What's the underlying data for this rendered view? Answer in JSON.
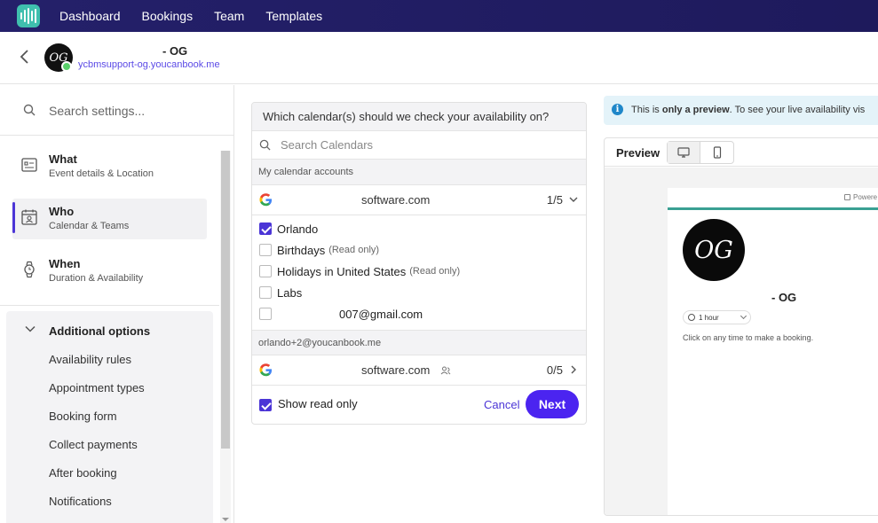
{
  "nav": {
    "items": [
      "Dashboard",
      "Bookings",
      "Team",
      "Templates"
    ]
  },
  "header": {
    "avatar_initials": "OG",
    "name": "- OG",
    "url": "ycbmsupport-og.youcanbook.me"
  },
  "sidebar": {
    "search_placeholder": "Search settings...",
    "sections": [
      {
        "title": "What",
        "subtitle": "Event details & Location",
        "icon": "id-card-icon",
        "active": false
      },
      {
        "title": "Who",
        "subtitle": "Calendar & Teams",
        "icon": "calendar-user-icon",
        "active": true
      },
      {
        "title": "When",
        "subtitle": "Duration & Availability",
        "icon": "watch-icon",
        "active": false
      }
    ],
    "additional": {
      "title": "Additional options",
      "options": [
        "Availability rules",
        "Appointment types",
        "Booking form",
        "Collect payments",
        "After booking",
        "Notifications"
      ]
    }
  },
  "calendar_panel": {
    "question": "Which calendar(s) should we check your availability on?",
    "search_placeholder": "Search Calendars",
    "sections": [
      {
        "label": "My calendar accounts",
        "account": "software.com",
        "count": "1/5",
        "expanded": true,
        "calendars": [
          {
            "name": "Orlando",
            "read_only": "",
            "checked": true
          },
          {
            "name": "Birthdays",
            "read_only": "(Read only)",
            "checked": false
          },
          {
            "name": "Holidays in United States",
            "read_only": "(Read only)",
            "checked": false
          },
          {
            "name": "Labs",
            "read_only": "",
            "checked": false
          },
          {
            "name": "007@gmail.com",
            "read_only": "",
            "checked": false
          }
        ]
      },
      {
        "label": "orlando+2@youcanbook.me",
        "account": "software.com",
        "count": "0/5",
        "expanded": false
      }
    ],
    "show_read_only_label": "Show read only",
    "show_read_only_checked": true,
    "cancel_label": "Cancel",
    "next_label": "Next"
  },
  "info_banner": {
    "prefix": "This is ",
    "bold": "only a preview",
    "suffix": ". To see your live availability vis"
  },
  "preview": {
    "label": "Preview",
    "powered_text": "Powere",
    "avatar_initials": "OG",
    "name": "- OG",
    "duration": "1 hour",
    "hint": "Click on any time to make a booking."
  },
  "colors": {
    "accent": "#4b24f0",
    "nav_bg": "#24206a",
    "brand_teal": "#3fbfae",
    "online": "#5ad16b",
    "preview_bar": "#3aa093"
  }
}
